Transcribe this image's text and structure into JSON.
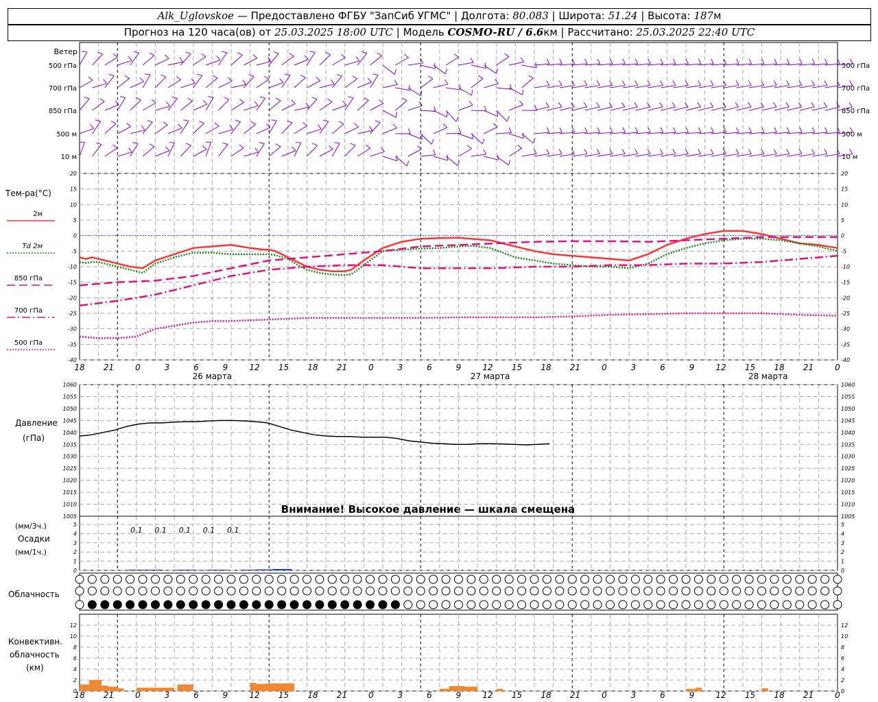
{
  "header": {
    "station": "Alk_Uglovskoe",
    "provider": " — Предоставлено ФГБУ \"ЗапСиб УГМС\" | Долгота: ",
    "lon": "80.083",
    "lat_label": " | Широта: ",
    "lat": "51.24",
    "alt_label": " | Высота: ",
    "alt": "187",
    "alt_unit": "м",
    "fc_label": "Прогноз на 120 часа(ов) от ",
    "fc_start": "25.03.2025 18:00 UTC",
    "model_label": " | Модель ",
    "model": "COSMO-RU / 6.6",
    "model_unit": "км",
    "calc_label": " | Рассчитано: ",
    "calc_time": "25.03.2025 22:40 UTC"
  },
  "time_axis": {
    "hour_ticks": [
      "18",
      "21",
      "0",
      "3",
      "6",
      "9",
      "12",
      "15",
      "18",
      "21",
      "0",
      "3",
      "6",
      "9",
      "12",
      "15",
      "18",
      "21",
      "0",
      "3",
      "6",
      "9",
      "12",
      "15",
      "18",
      "21",
      "0"
    ],
    "date_labels": [
      "26 марта",
      "27 марта",
      "28 марта"
    ]
  },
  "wind_panel": {
    "title": "Ветер",
    "levels": [
      "500 гПа",
      "700 гПа",
      "850 гПа",
      "500 м",
      "10 м"
    ],
    "color": "#8800cc"
  },
  "temp_panel": {
    "title": "Тем-ра(°C)",
    "legend": [
      {
        "label": "2м",
        "color": "#ff3333",
        "style": "solid"
      },
      {
        "label": "Td  2м",
        "color": "#118811",
        "style": "dotted"
      },
      {
        "label": "850 гПа",
        "color": "#dd1188",
        "style": "dash"
      },
      {
        "label": "700 гПа",
        "color": "#dd1188",
        "style": "dashdot"
      },
      {
        "label": "500 гПа",
        "color": "#dd1188",
        "style": "dotted"
      }
    ]
  },
  "pressure_panel": {
    "title": "Давление",
    "unit": "(гПа)",
    "warning": "Внимание! Высокое давление — шкала смещена"
  },
  "precip_panel": {
    "unit3": "(мм/3ч.)",
    "title": "Осадки",
    "unit1": "(мм/1ч.)",
    "labels": [
      "0.1",
      "0.1",
      "0.1",
      "0.1",
      "0.1"
    ]
  },
  "cloud_panel": {
    "title": "Облачность"
  },
  "conv_panel": {
    "title1": "Конвективн.",
    "title2": "облачность",
    "unit": "(км)"
  },
  "chart_data": [
    {
      "type": "line",
      "title": "Тем-ра(°C)",
      "x_unit": "hours from 25.03.2025 18:00 UTC",
      "ylim": [
        -40,
        20
      ],
      "yticks": [
        20,
        15,
        10,
        5,
        0,
        -5,
        -10,
        -15,
        -20,
        -25,
        -30,
        -35,
        -40
      ],
      "grid": true,
      "series": [
        {
          "name": "2м",
          "x": [
            0,
            1,
            2,
            3,
            4,
            5,
            6,
            8,
            10,
            12,
            15,
            18,
            21,
            24,
            27,
            29,
            30,
            31,
            33,
            35,
            36,
            38,
            39,
            40,
            42,
            43,
            45,
            48,
            51,
            54,
            57,
            60,
            62,
            63,
            65,
            67,
            69,
            72,
            75,
            78,
            81,
            84,
            87,
            90,
            93,
            96,
            99,
            102,
            105,
            108,
            111,
            114,
            117,
            120
          ],
          "y": [
            -7,
            -7.5,
            -7,
            -7.5,
            -8,
            -8.5,
            -9,
            -10,
            -10.5,
            -8,
            -6,
            -4,
            -3.5,
            -3,
            -4,
            -4.5,
            -4.5,
            -5,
            -7,
            -9,
            -10,
            -11,
            -11.2,
            -11.5,
            -11.5,
            -11,
            -8,
            -4,
            -2,
            -1,
            -0.8,
            -0.7,
            -1,
            -1.2,
            -1.5,
            -2.5,
            -3.5,
            -5,
            -6,
            -6.5,
            -7,
            -7.5,
            -8,
            -6,
            -3,
            -1,
            0.5,
            1.5,
            1.5,
            0.5,
            -1,
            -2.5,
            -3,
            -4
          ]
        },
        {
          "name": "Td  2м",
          "x": [
            0,
            1,
            2,
            3,
            4,
            5,
            6,
            8,
            10,
            12,
            15,
            18,
            21,
            24,
            27,
            29,
            30,
            31,
            33,
            35,
            36,
            38,
            39,
            40,
            42,
            43,
            45,
            48,
            51,
            54,
            57,
            60,
            62,
            63,
            65,
            67,
            69,
            72,
            75,
            78,
            81,
            84,
            87,
            90,
            93,
            96,
            99,
            102,
            105,
            108,
            111,
            114,
            117,
            120
          ],
          "y": [
            -8.5,
            -8.8,
            -8.5,
            -8.5,
            -9,
            -9.5,
            -10,
            -11,
            -12,
            -9,
            -7,
            -5.5,
            -5.5,
            -6,
            -6,
            -6,
            -6,
            -6.3,
            -7.5,
            -10,
            -11,
            -12,
            -12.3,
            -12.5,
            -12.7,
            -12.5,
            -9.5,
            -5,
            -4.5,
            -4.2,
            -4,
            -3.5,
            -3.3,
            -3.5,
            -4,
            -5.5,
            -7,
            -8,
            -9,
            -9.5,
            -10,
            -10,
            -10.5,
            -9,
            -6,
            -4,
            -2.5,
            -1.5,
            -1,
            -1,
            -1.5,
            -2.5,
            -3.5,
            -5
          ]
        },
        {
          "name": "850 гПа",
          "x": [
            0,
            6,
            12,
            18,
            24,
            30,
            36,
            42,
            48,
            54,
            60,
            66,
            72,
            78,
            84,
            90,
            96,
            102,
            108,
            114,
            120
          ],
          "y": [
            -16,
            -15,
            -14.5,
            -13,
            -10.5,
            -8,
            -7,
            -6,
            -5,
            -3.5,
            -3,
            -2.5,
            -2,
            -1.8,
            -1.8,
            -2,
            -1.5,
            -1,
            -0.5,
            -0.5,
            -0.5
          ]
        },
        {
          "name": "700 гПа",
          "x": [
            0,
            6,
            12,
            18,
            24,
            30,
            36,
            42,
            48,
            54,
            60,
            66,
            72,
            78,
            84,
            90,
            96,
            102,
            108,
            114,
            120
          ],
          "y": [
            -22.5,
            -21,
            -19,
            -16,
            -13,
            -11,
            -10,
            -9.5,
            -9.5,
            -10.5,
            -10.5,
            -10.5,
            -10,
            -10,
            -9.5,
            -9.5,
            -9,
            -9,
            -8.5,
            -7.5,
            -6.5
          ]
        },
        {
          "name": "500 гПа",
          "x": [
            0,
            3,
            6,
            9,
            12,
            15,
            18,
            21,
            24,
            30,
            36,
            42,
            48,
            54,
            60,
            66,
            72,
            78,
            84,
            90,
            96,
            102,
            108,
            114,
            120
          ],
          "y": [
            -32.5,
            -33,
            -33,
            -32.5,
            -30,
            -29,
            -28,
            -27.5,
            -27.5,
            -27,
            -26.5,
            -26.5,
            -26.5,
            -26.5,
            -26.3,
            -26.3,
            -26.3,
            -26,
            -25.5,
            -25.3,
            -25,
            -25,
            -25,
            -25.5,
            -25.8
          ]
        }
      ]
    },
    {
      "type": "line",
      "title": "Давление",
      "ylim": [
        1005,
        1060
      ],
      "yticks": [
        1060,
        1055,
        1050,
        1045,
        1040,
        1035,
        1030,
        1025,
        1020,
        1015,
        1010,
        1005
      ],
      "series": [
        {
          "name": "",
          "x": [
            0,
            3,
            6,
            9,
            12,
            15,
            18,
            21,
            24,
            27,
            30,
            33,
            36,
            39,
            42,
            45,
            48,
            51,
            54,
            57,
            60,
            63,
            66,
            69,
            72,
            75,
            78,
            81,
            84,
            87,
            90,
            93,
            96,
            99,
            102,
            105,
            108,
            111,
            114,
            117,
            120
          ],
          "y": [
            1038.5,
            1039,
            1040,
            1041,
            1042.5,
            1043.5,
            1044,
            1044,
            1044.3,
            1044.5,
            1044.5,
            1044.8,
            1045,
            1045,
            1044.8,
            1044.5,
            1044,
            1042.5,
            1041,
            1040,
            1039,
            1038.5,
            1038.3,
            1038.3,
            1038,
            1038,
            1038,
            1037.5,
            1036.5,
            1036,
            1035.5,
            1035.3,
            1035,
            1035,
            1035.3,
            1035.3,
            1035.2,
            1035,
            1034.8,
            1035,
            1035.3
          ]
        }
      ]
    },
    {
      "type": "bar",
      "title": "Осадки",
      "ylim": [
        0,
        5
      ],
      "yticks": [
        5,
        4,
        3,
        2,
        1,
        0
      ],
      "x": [
        9,
        12,
        15,
        18,
        21,
        24,
        27,
        30,
        33,
        36
      ],
      "values": [
        0.05,
        0.05,
        0,
        0.05,
        0.03,
        0.05,
        0,
        0.05,
        0.07,
        0.1
      ]
    },
    {
      "type": "bar",
      "title": "Конвективн. облачность (км)",
      "ylim": [
        0,
        14
      ],
      "yticks": [
        12,
        10,
        8,
        6,
        4,
        2,
        0
      ],
      "segments": [
        {
          "x0": 0,
          "x1": 1.5,
          "top": 1.2
        },
        {
          "x0": 1.5,
          "x1": 3.5,
          "top": 2.0
        },
        {
          "x0": 3.5,
          "x1": 4.5,
          "top": 1.0
        },
        {
          "x0": 4.5,
          "x1": 6.0,
          "top": 0.8
        },
        {
          "x0": 6.0,
          "x1": 7.0,
          "top": 0.5
        },
        {
          "x0": 9.0,
          "x1": 11.0,
          "top": 0.6
        },
        {
          "x0": 11.0,
          "x1": 15.0,
          "top": 0.6
        },
        {
          "x0": 15.5,
          "x1": 16.5,
          "top": 1.2
        },
        {
          "x0": 16.5,
          "x1": 18.0,
          "top": 1.2
        },
        {
          "x0": 27.0,
          "x1": 28.0,
          "top": 1.5
        },
        {
          "x0": 28.0,
          "x1": 29.5,
          "top": 1.3
        },
        {
          "x0": 29.5,
          "x1": 34.0,
          "top": 1.4
        },
        {
          "x0": 57.0,
          "x1": 58.5,
          "top": 0.4
        },
        {
          "x0": 58.5,
          "x1": 61.0,
          "top": 0.9
        },
        {
          "x0": 61.0,
          "x1": 63.0,
          "top": 0.8
        },
        {
          "x0": 66.0,
          "x1": 67.0,
          "top": 0.4
        },
        {
          "x0": 96.0,
          "x1": 97.5,
          "top": 0.4
        },
        {
          "x0": 97.5,
          "x1": 98.5,
          "top": 0.6
        },
        {
          "x0": 108.0,
          "x1": 109.0,
          "top": 0.5
        }
      ]
    }
  ]
}
